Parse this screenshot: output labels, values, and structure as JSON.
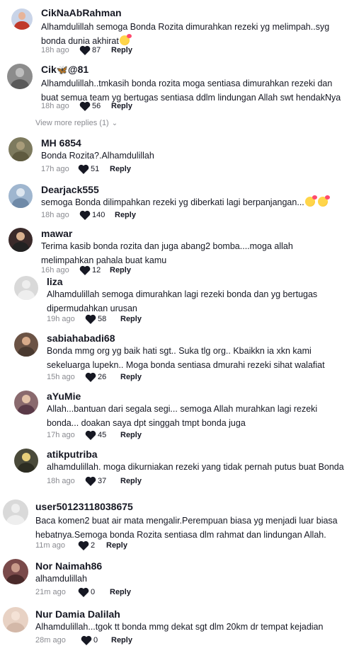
{
  "colors": {
    "text": "#161823",
    "muted": "#8a8b91",
    "heart": "#161823",
    "avatar_placeholder": "#d9d9d9"
  },
  "icons": {
    "like": "heart-icon",
    "expand": "chevron-down-icon",
    "avatar_default": "default-avatar-icon"
  },
  "view_more_replies": "View more replies (1)",
  "comments": [
    {
      "username": "CikNaAbRahman",
      "text": "Alhamdulillah semoga Bonda Rozita dimurahkan rezeki yg melimpah..syg bonda dunia akhirat",
      "emoji": "smiling-face-with-hearts",
      "time": "18h ago",
      "likes": "87",
      "reply": "Reply",
      "avatar_color": "#c9d4e8"
    },
    {
      "username_prefix": "Cik",
      "username_emoji": "🦋",
      "username_suffix": "@81",
      "text": "Alhamdulillah..tmkasih bonda rozita moga sentiasa dimurahkan rezeki dan buat semua team yg bertugas sentiasa ddlm lindungan Allah swt hendakNya",
      "time": "18h ago",
      "likes": "56",
      "reply": "Reply",
      "avatar_color": "#8c8c8c"
    },
    {
      "username": "MH 6854",
      "text": "Bonda Rozita?.Alhamdulillah",
      "time": "17h ago",
      "likes": "51",
      "reply": "Reply",
      "avatar_color": "#7d7a5e"
    },
    {
      "username": "Dearjack555",
      "text": "semoga Bonda dilimpahkan rezeki yg diberkati lagi berpanjangan...",
      "emoji_count": 2,
      "time": "18h ago",
      "likes": "140",
      "reply": "Reply",
      "avatar_color": "#9fb6cf"
    },
    {
      "username": "mawar",
      "text": "Terima kasib bonda rozita dan juga abang2 bomba....moga allah melimpahkan pahala buat kamu",
      "time": "16h ago",
      "likes": "12",
      "reply": "Reply",
      "avatar_color": "#3a2a2a"
    },
    {
      "username": "liza",
      "text": "Alhamdulillah semoga dimurahkan lagi rezeki bonda dan yg bertugas dipermudahkan urusan",
      "time": "19h ago",
      "likes": "58",
      "reply": "Reply",
      "avatar_color": "#d9d9d9"
    },
    {
      "username": "sabiahabadi68",
      "text": "Bonda mmg org yg baik hati sgt.. Suka tlg org.. Kbaikkn ia xkn kami sekeluarga lupekn.. Moga bonda sentiasa dmurahi rezeki sihat walafiat",
      "time": "15h ago",
      "likes": "26",
      "reply": "Reply",
      "avatar_color": "#6b5345"
    },
    {
      "username": "aYuMie",
      "text": "Allah...bantuan dari segala segi... semoga Allah murahkan lagi rezeki bonda... doakan saya dpt singgah tmpt bonda juga",
      "time": "17h ago",
      "likes": "45",
      "reply": "Reply",
      "avatar_color": "#8a6a6e"
    },
    {
      "username": "atikputriba",
      "text": "alhamdulillah. moga dikurniakan rezeki yang tidak pernah putus buat Bonda",
      "time": "18h ago",
      "likes": "37",
      "reply": "Reply",
      "avatar_color": "#4a4a3a"
    },
    {
      "username": "user50123118038675",
      "text": "Baca komen2 buat air mata mengalir.Perempuan biasa yg menjadi luar biasa hebatnya.Semoga bonda Rozita sentiasa dlm rahmat dan lindungan Allah.",
      "time": "11m ago",
      "likes": "2",
      "reply": "Reply",
      "avatar_color": "#d9d9d9"
    },
    {
      "username": "Nor Naimah86",
      "text": "alhamdulillah",
      "time": "21m ago",
      "likes": "0",
      "reply": "Reply",
      "avatar_color": "#7a4a4a"
    },
    {
      "username": "Nur Damia Dalilah",
      "text": "Alhamdulillah...tgok tt bonda mmg dekat sgt dlm 20km dr tempat kejadian",
      "time": "28m ago",
      "likes": "0",
      "reply": "Reply",
      "avatar_color": "#e8d2c4"
    }
  ]
}
